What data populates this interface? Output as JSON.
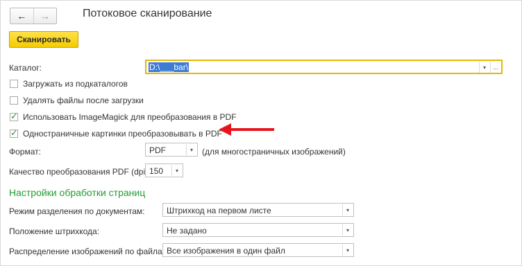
{
  "nav": {
    "back_icon": "arrow-left-icon",
    "forward_icon": "arrow-right-icon"
  },
  "title": "Потоковое сканирование",
  "scan_button": "Сканировать",
  "catalog": {
    "label": "Каталог:",
    "value": "D:\\___bar\\",
    "more": "..."
  },
  "checkboxes": [
    {
      "label": "Загружать из подкаталогов",
      "checked": false
    },
    {
      "label": "Удалять файлы после загрузки",
      "checked": false
    },
    {
      "label": "Использовать ImageMagick для преобразования в PDF",
      "checked": true
    },
    {
      "label": "Одностраничные картинки преобразовывать в PDF",
      "checked": true
    }
  ],
  "format": {
    "label": "Формат:",
    "value": "PDF",
    "hint": "(для многостраничных изображений)"
  },
  "quality": {
    "label": "Качество преобразования PDF (dpi):",
    "value": "150"
  },
  "section_title": "Настройки обработки страниц",
  "settings": [
    {
      "label": "Режим разделения по документам:",
      "value": "Штрихкод на первом листе"
    },
    {
      "label": "Положение штрихкода:",
      "value": "Не задано"
    },
    {
      "label": "Распределение изображений по файлам:",
      "value": "Все изображения в один файл"
    }
  ],
  "colors": {
    "accent_yellow": "#f5cc00",
    "section_green": "#1f9d2f",
    "annotation_red": "#e8141b"
  }
}
